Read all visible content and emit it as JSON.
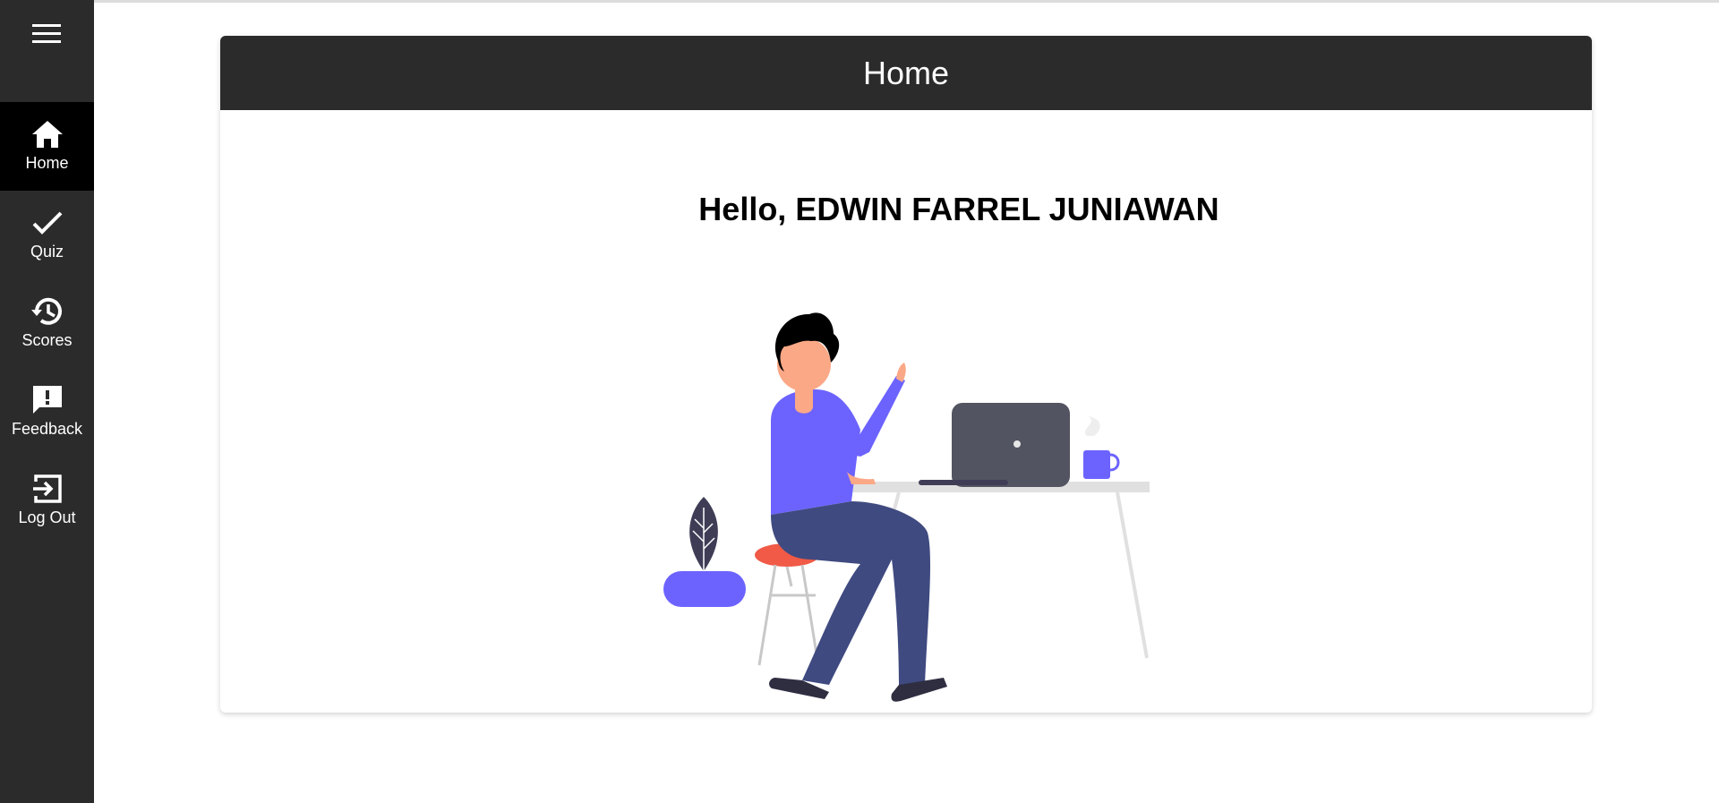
{
  "sidebar": {
    "menu_icon": "hamburger-menu-icon",
    "items": [
      {
        "label": "Home",
        "icon": "home-icon",
        "active": true
      },
      {
        "label": "Quiz",
        "icon": "check-icon",
        "active": false
      },
      {
        "label": "Scores",
        "icon": "history-icon",
        "active": false
      },
      {
        "label": "Feedback",
        "icon": "feedback-icon",
        "active": false
      },
      {
        "label": "Log Out",
        "icon": "logout-icon",
        "active": false
      }
    ]
  },
  "main": {
    "title": "Home",
    "greeting": "Hello, EDWIN FARREL JUNIAWAN"
  },
  "colors": {
    "sidebar_bg": "#2b2b2b",
    "active_bg": "#000000",
    "accent": "#6c63ff",
    "pants": "#3f4a80"
  }
}
